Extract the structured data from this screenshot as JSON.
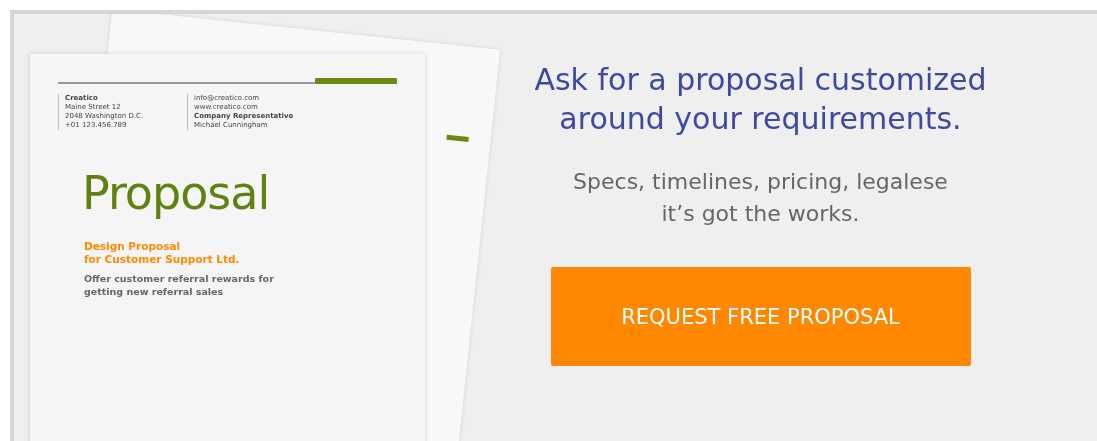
{
  "document": {
    "sender": [
      "Creatico",
      "Maine Street 12",
      "2048 Washington D.C.",
      "+01 123.456.789"
    ],
    "contact": [
      "info@creatico.com",
      "www.creatico.com",
      "Company Representative",
      "Michael Cunningham"
    ],
    "title": "Proposal",
    "subtitle": [
      "Design Proposal",
      "for Customer Support Ltd."
    ],
    "description": [
      "Offer customer referral rewards for",
      "getting new referral sales"
    ]
  },
  "headline": [
    "Ask for a proposal customized",
    "around your requirements."
  ],
  "tagline": [
    "Specs, timelines, pricing, legalese",
    "it’s got the works."
  ],
  "cta_button": "REQUEST FREE PROPOSAL"
}
